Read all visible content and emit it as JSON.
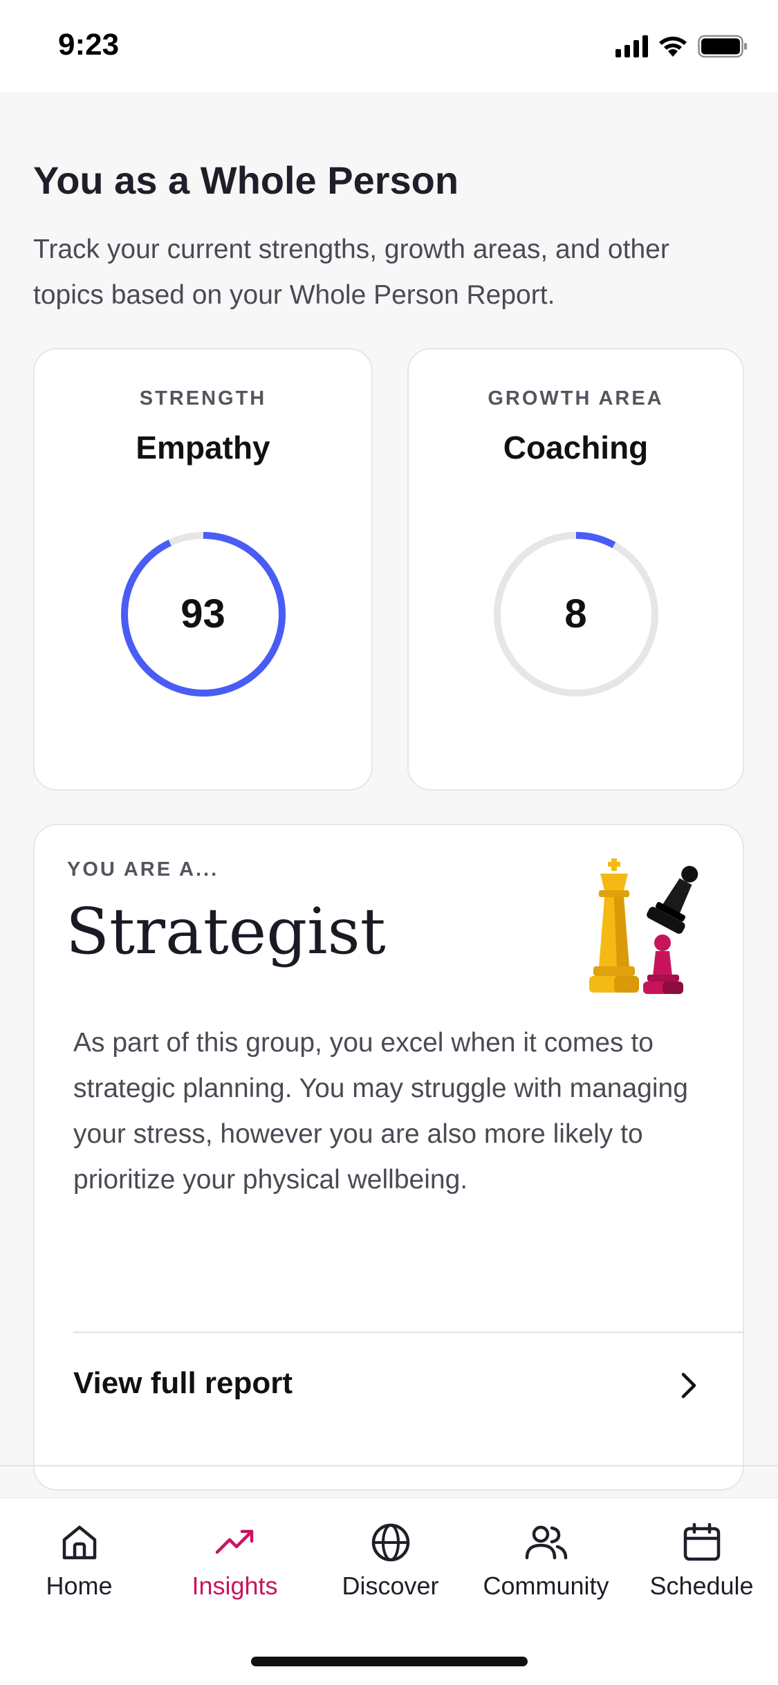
{
  "status_bar": {
    "time": "9:23"
  },
  "section": {
    "title": "You as a Whole Person",
    "description": "Track your current strengths, growth areas, and other topics based on your Whole Person Report."
  },
  "score_cards": [
    {
      "eyebrow": "STRENGTH",
      "topic": "Empathy",
      "value": "93",
      "progress_percent": 93
    },
    {
      "eyebrow": "GROWTH AREA",
      "topic": "Coaching",
      "value": "8",
      "progress_percent": 8
    }
  ],
  "type_card": {
    "eyebrow": "YOU ARE A...",
    "title": "Strategist",
    "body": "As part of this group, you excel when it comes to strategic planning. You may struggle with managing your stress, however you are also more likely to prioritize your physical wellbeing.",
    "link_label": "View full report"
  },
  "tab_bar": {
    "tabs": [
      {
        "label": "Home",
        "icon": "home-icon",
        "active": false
      },
      {
        "label": "Insights",
        "icon": "trending-up-icon",
        "active": true
      },
      {
        "label": "Discover",
        "icon": "globe-icon",
        "active": false
      },
      {
        "label": "Community",
        "icon": "users-icon",
        "active": false
      },
      {
        "label": "Schedule",
        "icon": "calendar-icon",
        "active": false
      }
    ]
  },
  "colors": {
    "accent_ring": "#4a5cf6",
    "ring_track": "#e6e6e8",
    "active_tab": "#c8145c",
    "chess_gold": "#f5b914",
    "chess_pink": "#c8145c"
  }
}
